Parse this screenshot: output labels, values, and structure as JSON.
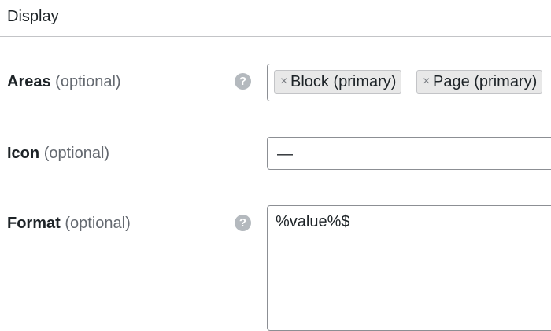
{
  "section": {
    "title": "Display"
  },
  "fields": {
    "areas": {
      "label": "Areas",
      "optional": "(optional)",
      "help_glyph": "?",
      "help_icon": "question-circle-icon",
      "tags": [
        {
          "remove_glyph": "×",
          "label": "Block (primary)"
        },
        {
          "remove_glyph": "×",
          "label": "Page (primary)"
        }
      ]
    },
    "icon": {
      "label": "Icon",
      "optional": "(optional)",
      "value": "—"
    },
    "format": {
      "label": "Format",
      "optional": "(optional)",
      "help_glyph": "?",
      "help_icon": "question-circle-icon",
      "value": "%value%$"
    }
  },
  "colors": {
    "help_icon_bg": "#b4b9be",
    "tag_bg": "#e8e8e8",
    "border": "#8c8f94",
    "optional_text": "#646970"
  }
}
